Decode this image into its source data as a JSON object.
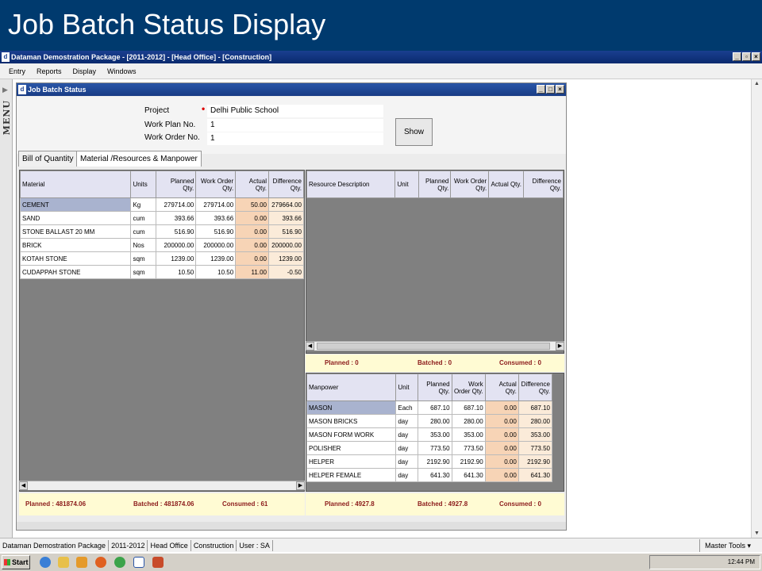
{
  "slide": {
    "title": "Job Batch Status Display"
  },
  "app": {
    "title": "Dataman Demostration Package - [2011-2012] - [Head Office] - [Construction]",
    "menu": [
      "Entry",
      "Reports",
      "Display",
      "Windows"
    ],
    "side_menu_label": "MENU"
  },
  "window": {
    "title": "Job Batch Status",
    "project_label": "Project",
    "project_value": "Delhi Public School",
    "work_plan_label": "Work Plan No.",
    "work_plan_value": "1",
    "work_order_label": "Work Order No.",
    "work_order_value": "1",
    "show_button": "Show",
    "tabs": [
      "Bill of Quantity",
      "Material /Resources & Manpower"
    ]
  },
  "material_table": {
    "headers": [
      "Material",
      "Units",
      "Planned Qty.",
      "Work Order Qty.",
      "Actual Qty.",
      "Difference Qty."
    ],
    "rows": [
      [
        "CEMENT",
        "Kg",
        "279714.00",
        "279714.00",
        "50.00",
        "279664.00"
      ],
      [
        "SAND",
        "cum",
        "393.66",
        "393.66",
        "0.00",
        "393.66"
      ],
      [
        "STONE BALLAST 20 MM",
        "cum",
        "516.90",
        "516.90",
        "0.00",
        "516.90"
      ],
      [
        "BRICK",
        "Nos",
        "200000.00",
        "200000.00",
        "0.00",
        "200000.00"
      ],
      [
        "KOTAH STONE",
        "sqm",
        "1239.00",
        "1239.00",
        "0.00",
        "1239.00"
      ],
      [
        "CUDAPPAH STONE",
        "sqm",
        "10.50",
        "10.50",
        "11.00",
        "-0.50"
      ]
    ]
  },
  "resource_table": {
    "headers": [
      "Resource Description",
      "Unit",
      "Planned Qty.",
      "Work Order Qty.",
      "Actual Qty.",
      "Difference Qty."
    ]
  },
  "resource_summary": {
    "planned": "Planned : 0",
    "batched": "Batched : 0",
    "consumed": "Consumed : 0"
  },
  "manpower_table": {
    "headers": [
      "Manpower",
      "Unit",
      "Planned Qty.",
      "Work Order Qty.",
      "Actual Qty.",
      "Difference Qty."
    ],
    "rows": [
      [
        "MASON",
        "Each",
        "687.10",
        "687.10",
        "0.00",
        "687.10"
      ],
      [
        "MASON BRICKS",
        "day",
        "280.00",
        "280.00",
        "0.00",
        "280.00"
      ],
      [
        "MASON FORM WORK",
        "day",
        "353.00",
        "353.00",
        "0.00",
        "353.00"
      ],
      [
        "POLISHER",
        "day",
        "773.50",
        "773.50",
        "0.00",
        "773.50"
      ],
      [
        "HELPER",
        "day",
        "2192.90",
        "2192.90",
        "0.00",
        "2192.90"
      ],
      [
        "HELPER FEMALE",
        "day",
        "641.30",
        "641.30",
        "0.00",
        "641.30"
      ]
    ]
  },
  "material_summary": {
    "planned": "Planned : 481874.06",
    "batched": "Batched : 481874.06",
    "consumed": "Consumed : 61"
  },
  "manpower_summary": {
    "planned": "Planned : 4927.8",
    "batched": "Batched : 4927.8",
    "consumed": "Consumed : 0"
  },
  "statusbar": {
    "cells": [
      "Dataman Demostration Package",
      "2011-2012",
      "Head Office",
      "Construction",
      "User : SA"
    ],
    "master_tools": "Master Tools"
  },
  "taskbar": {
    "start": "Start",
    "clock": "12:44 PM"
  }
}
